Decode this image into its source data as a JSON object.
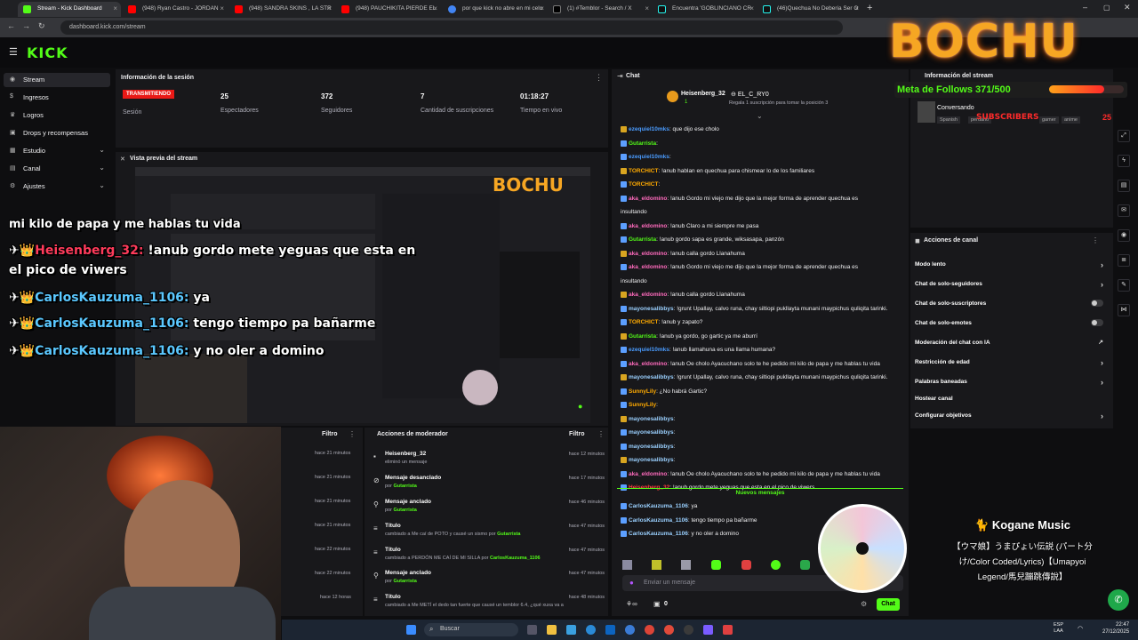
{
  "browser": {
    "tabs": [
      {
        "title": "Stream - Kick Dashboard",
        "active": true
      },
      {
        "title": "(948) Ryan Castro - JORDAN"
      },
      {
        "title": "(948) SANDRA SKINS , LA STR"
      },
      {
        "title": "(948) PAUCHIKITA PIERDE EL"
      },
      {
        "title": "por que kick no abre en mi celu"
      },
      {
        "title": "(1) #Temblor - Search / X"
      },
      {
        "title": "Encuentra 'GOBLINCIANO CR"
      },
      {
        "title": "(46)Quechua No Deberia Ser O"
      }
    ],
    "url": "dashboard.kick.com/stream"
  },
  "brand": {
    "logo": "KICK",
    "accent": "#53fc18"
  },
  "sidebar": {
    "items": [
      {
        "label": "Stream",
        "icon": "broadcast-icon"
      },
      {
        "label": "Ingresos",
        "icon": "dollar-icon"
      },
      {
        "label": "Logros",
        "icon": "trophy-icon"
      },
      {
        "label": "Drops y recompensas",
        "icon": "gift-icon"
      },
      {
        "label": "Estudio",
        "icon": "studio-icon"
      },
      {
        "label": "Canal",
        "icon": "channel-icon"
      },
      {
        "label": "Ajustes",
        "icon": "gear-icon"
      }
    ]
  },
  "session": {
    "title": "Información de la sesión",
    "live_badge": "TRANSMITIENDO",
    "session_label": "Sesión",
    "stats": [
      {
        "value": "25",
        "label": "Espectadores"
      },
      {
        "value": "372",
        "label": "Seguidores"
      },
      {
        "value": "7",
        "label": "Cantidad de suscripciones"
      },
      {
        "value": "01:18:27",
        "label": "Tiempo en vivo"
      }
    ]
  },
  "preview": {
    "title": "Vista previa del stream"
  },
  "overlay": {
    "logo": "BOCHU",
    "follow_goal": "Meta de Follows 371/500",
    "follow_goal_progress": 0.742,
    "subscribers_label": "SUBSCRIBERS",
    "subscribers_count": "25",
    "lines": [
      {
        "user": "",
        "text": "mi kilo de papa y me hablas tu vida"
      },
      {
        "user": "Heisenberg_32:",
        "text": " !anub gordo mete yeguas que esta en"
      },
      {
        "user": "",
        "text": "el pico de viwers"
      },
      {
        "user": "CarlosKauzuma_1106:",
        "text": " ya"
      },
      {
        "user": "CarlosKauzuma_1106:",
        "text": " tengo tiempo pa bañarme"
      },
      {
        "user": "CarlosKauzuma_1106:",
        "text": " y no oler a domino"
      }
    ],
    "music": {
      "title": "Kogane Music",
      "line1": "【ウマ娘】うまぴょい伝説 (パート分",
      "line2": "け/Color Coded/Lyrics)【Umapyoi",
      "line3": "Legend/馬兒蹦跳傳說】"
    }
  },
  "feed": {
    "filter_label": "Filtro",
    "times": [
      "hace 21 minutos",
      "hace 21 minutos",
      "hace 21 minutos",
      "hace 21 minutos",
      "hace 22 minutos",
      "hace 22 minutos",
      "hace 12 horas"
    ]
  },
  "mod_actions": {
    "title": "Acciones de moderador",
    "filter_label": "Filtro",
    "rows": [
      {
        "title": "Heisenberg_32",
        "sub": "eliminó un mensaje",
        "by": "",
        "time": "hace 12 minutos",
        "icon": "user-icon"
      },
      {
        "title": "Mensaje desanclado",
        "sub": "por",
        "by": "Gutarrista",
        "time": "hace 17 minutos",
        "icon": "unpin-icon"
      },
      {
        "title": "Mensaje anclado",
        "sub": "por",
        "by": "Gutarrista",
        "time": "hace 46 minutos",
        "icon": "pin-icon"
      },
      {
        "title": "Título",
        "sub": "cambiado a Me caí de POTO y causé un sismo por",
        "by": "Gutarrista",
        "time": "hace 47 minutos",
        "icon": "title-icon"
      },
      {
        "title": "Título",
        "sub": "cambiado a PERDÓN ME CAÍ DE MI SILLA por",
        "by": "CarlosKauzuma_1106",
        "time": "hace 47 minutos",
        "icon": "title-icon"
      },
      {
        "title": "Mensaje anclado",
        "sub": "por",
        "by": "Gutarrista",
        "time": "hace 47 minutos",
        "icon": "pin-icon"
      },
      {
        "title": "Título",
        "sub": "cambiado a Me METÍ el dedo tan fuerte que causé un temblor 6.4, ¿qué xuxa va a",
        "by": "",
        "time": "hace 48 minutos",
        "icon": "title-icon"
      }
    ]
  },
  "chat": {
    "title": "Chat",
    "pinned_user": "Heisenberg_32",
    "pinned_user2": "EL_C_RY0",
    "pinned_count": "1",
    "pinned_note": "Regala 1 suscripción para tomar la posición 3",
    "messages": [
      {
        "user": "ezequiel10mks",
        "text": ": que dijo ese cholo",
        "c": "g2"
      },
      {
        "user": "Gutarrista",
        "text": ":",
        "c": "g1"
      },
      {
        "user": "ezequiel10mks",
        "text": ":",
        "c": "g2"
      },
      {
        "user": "TORCHICT",
        "text": ": !anub hablan en quechua para chismear lo de los familiares",
        "c": "g4"
      },
      {
        "user": "TORCHICT",
        "text": ":",
        "c": "g4"
      },
      {
        "user": "aka_eldomino",
        "text": ": !anub Gordo mi viejo me dijo que la mejor forma de aprender quechua es",
        "c": "g3"
      },
      {
        "user": "",
        "text": "insultando",
        "c": "g3"
      },
      {
        "user": "aka_eldomino",
        "text": ": !anub Claro a mi siempre me pasa",
        "c": "g3"
      },
      {
        "user": "Gutarrista",
        "text": ": !anub gordo sapa es grande, wiksasapa, panzón",
        "c": "g1"
      },
      {
        "user": "aka_eldomino",
        "text": ": !anub calla gordo Llanahuma",
        "c": "g3"
      },
      {
        "user": "aka_eldomino",
        "text": ": !anub Gordo mi viejo me dijo que la mejor forma de aprender quechua es",
        "c": "g3"
      },
      {
        "user": "",
        "text": "insultando",
        "c": "g3"
      },
      {
        "user": "aka_eldomino",
        "text": ": !anub calla gordo Llanahuma",
        "c": "g3"
      },
      {
        "user": "mayonesalibbys",
        "text": ": !grunt Upallay, calvo runa, chay siltiopi pukllayta munani maypichus quliqita tarinki.",
        "c": "g6"
      },
      {
        "user": "TORCHICT",
        "text": ": !anub y zapato?",
        "c": "g4"
      },
      {
        "user": "Gutarrista",
        "text": ": !anub ya gordo, go gartic ya me aburrí",
        "c": "g1"
      },
      {
        "user": "ezequiel10mks",
        "text": ": !anub llamahuna es una llama humana?",
        "c": "g2"
      },
      {
        "user": "aka_eldomino",
        "text": ": !anub Oe cholo Ayacuchano solo te he pedido mi kilo de papa y me hablas tu vida",
        "c": "g3"
      },
      {
        "user": "mayonesalibbys",
        "text": ": !grunt Upallay, calvo runa, chay siltiopi pukllayta munani maypichus quliqita tarinki.",
        "c": "g6"
      },
      {
        "user": "SunnyLily",
        "text": ": ¿No habrá Gartic?",
        "c": "g4"
      },
      {
        "user": "SunnyLily",
        "text": ":",
        "c": "g4"
      },
      {
        "user": "mayonesalibbys",
        "text": ":",
        "c": "g6"
      },
      {
        "user": "mayonesalibbys",
        "text": ":",
        "c": "g6"
      },
      {
        "user": "mayonesalibbys",
        "text": ":",
        "c": "g6"
      },
      {
        "user": "mayonesalibbys",
        "text": ":",
        "c": "g6"
      },
      {
        "user": "aka_eldomino",
        "text": ": !anub Oe cholo Ayacuchano solo te he pedido mi kilo de papa y me hablas tu vida",
        "c": "g3"
      },
      {
        "user": "Heisenberg_32",
        "text": ": !anub gordo mete yeguas que esta en el pico de viwers",
        "c": "g5"
      }
    ],
    "new_messages_label": "Nuevos mensajes",
    "new_messages": [
      {
        "user": "CarlosKauzuma_1106",
        "text": ": ya",
        "c": "g6"
      },
      {
        "user": "CarlosKauzuma_1106",
        "text": ": tengo tiempo pa bañarme",
        "c": "g6"
      },
      {
        "user": "CarlosKauzuma_1106",
        "text": ": y no oler a domino",
        "c": "g6"
      }
    ],
    "input_placeholder": "Enviar un mensaje",
    "points": "0",
    "send_label": "Chat"
  },
  "stream_info": {
    "title": "Información del stream",
    "category": "Conversando",
    "tags": [
      "Spanish",
      "peruano",
      "gamer",
      "anime"
    ]
  },
  "channel_actions": {
    "title": "Acciones de canal",
    "items": [
      {
        "label": "Modo lento",
        "control": "arrow"
      },
      {
        "label": "Chat de solo-seguidores",
        "control": "arrow"
      },
      {
        "label": "Chat de solo-suscriptores",
        "control": "toggle"
      },
      {
        "label": "Chat de solo-emotes",
        "control": "toggle"
      },
      {
        "label": "Moderación del chat con IA",
        "control": "link"
      },
      {
        "label": "Restricción de edad",
        "control": "arrow"
      },
      {
        "label": "Palabras baneadas",
        "control": "arrow"
      },
      {
        "label": "Hostear canal",
        "control": "none"
      },
      {
        "label": "Configurar objetivos",
        "control": "arrow"
      }
    ]
  },
  "taskbar": {
    "search_placeholder": "Buscar",
    "lang": "ESP",
    "lang2": "LAA",
    "time": "22:47",
    "date": "27/12/2025"
  }
}
